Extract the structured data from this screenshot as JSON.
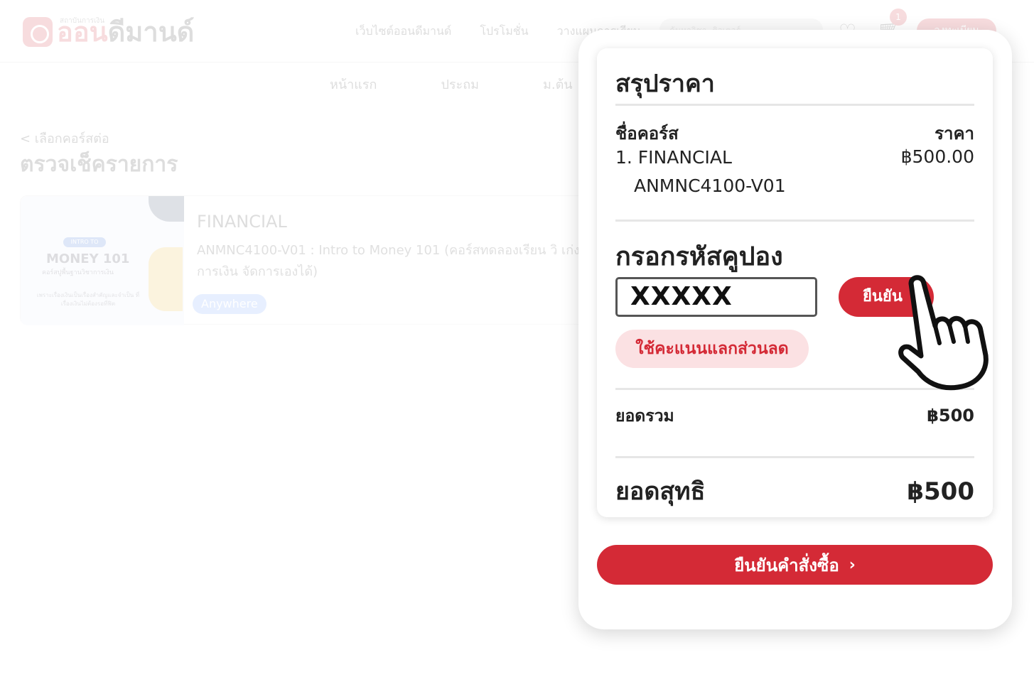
{
  "header": {
    "logo_tagline": "สถาบันการเงิน",
    "logo_red": "ออน",
    "logo_dark": "ดีมานด์",
    "nav": [
      "เว็บไซต์ออนดีมานด์",
      "โปรโมชั่น",
      "วางแผนการเรียน"
    ],
    "search_placeholder": "ค้นหาวิชา, ติวเตอร์",
    "cart_count": "1",
    "login_label": "ลงทะเบียน"
  },
  "subnav": [
    "หน้าแรก",
    "ประถม",
    "ม.ต้น"
  ],
  "page": {
    "back_link": "< เลือกคอร์สต่อ",
    "title": "ตรวจเช็ครายการ"
  },
  "course_card": {
    "thumb_tag": "INTRO TO",
    "thumb_title": "MONEY 101",
    "thumb_subtitle": "คอร์สปูพื้นฐานวิชาการเงิน",
    "thumb_footer": "เพราะเรื่องเงินเป็นเรื่องสำคัญและจำเป็น ที่เรื่องเงินไม่ต้องรอที่ฟิต",
    "category": "FINANCIAL",
    "description": "ANMNC4100-V01 : Intro to Money 101 (คอร์สทดลองเรียน วิ เก่งการเงิน จัดการเองได้)",
    "badge": "Anywhere"
  },
  "summary": {
    "title": "สรุปราคา",
    "col_course": "ชื่อคอร์ส",
    "col_price": "ราคา",
    "item_line1": "1. FINANCIAL",
    "item_line2": "ANMNC4100-V01",
    "item_price": "฿500.00",
    "coupon_title": "กรอกรหัสคูปอง",
    "coupon_value": "XXXXX",
    "confirm_label": "ยืนยัน",
    "points_label": "ใช้คะแนนแลกส่วนลด",
    "subtotal_label": "ยอดรวม",
    "subtotal_value": "฿500",
    "net_label": "ยอดสุทธิ",
    "net_value": "฿500"
  },
  "order_button": {
    "label": "ยืนยันคำสั่งซื้อ",
    "chevron": "›"
  },
  "colors": {
    "accent": "#d42a36",
    "accent_light": "#fbe1e3",
    "text": "#222222"
  }
}
